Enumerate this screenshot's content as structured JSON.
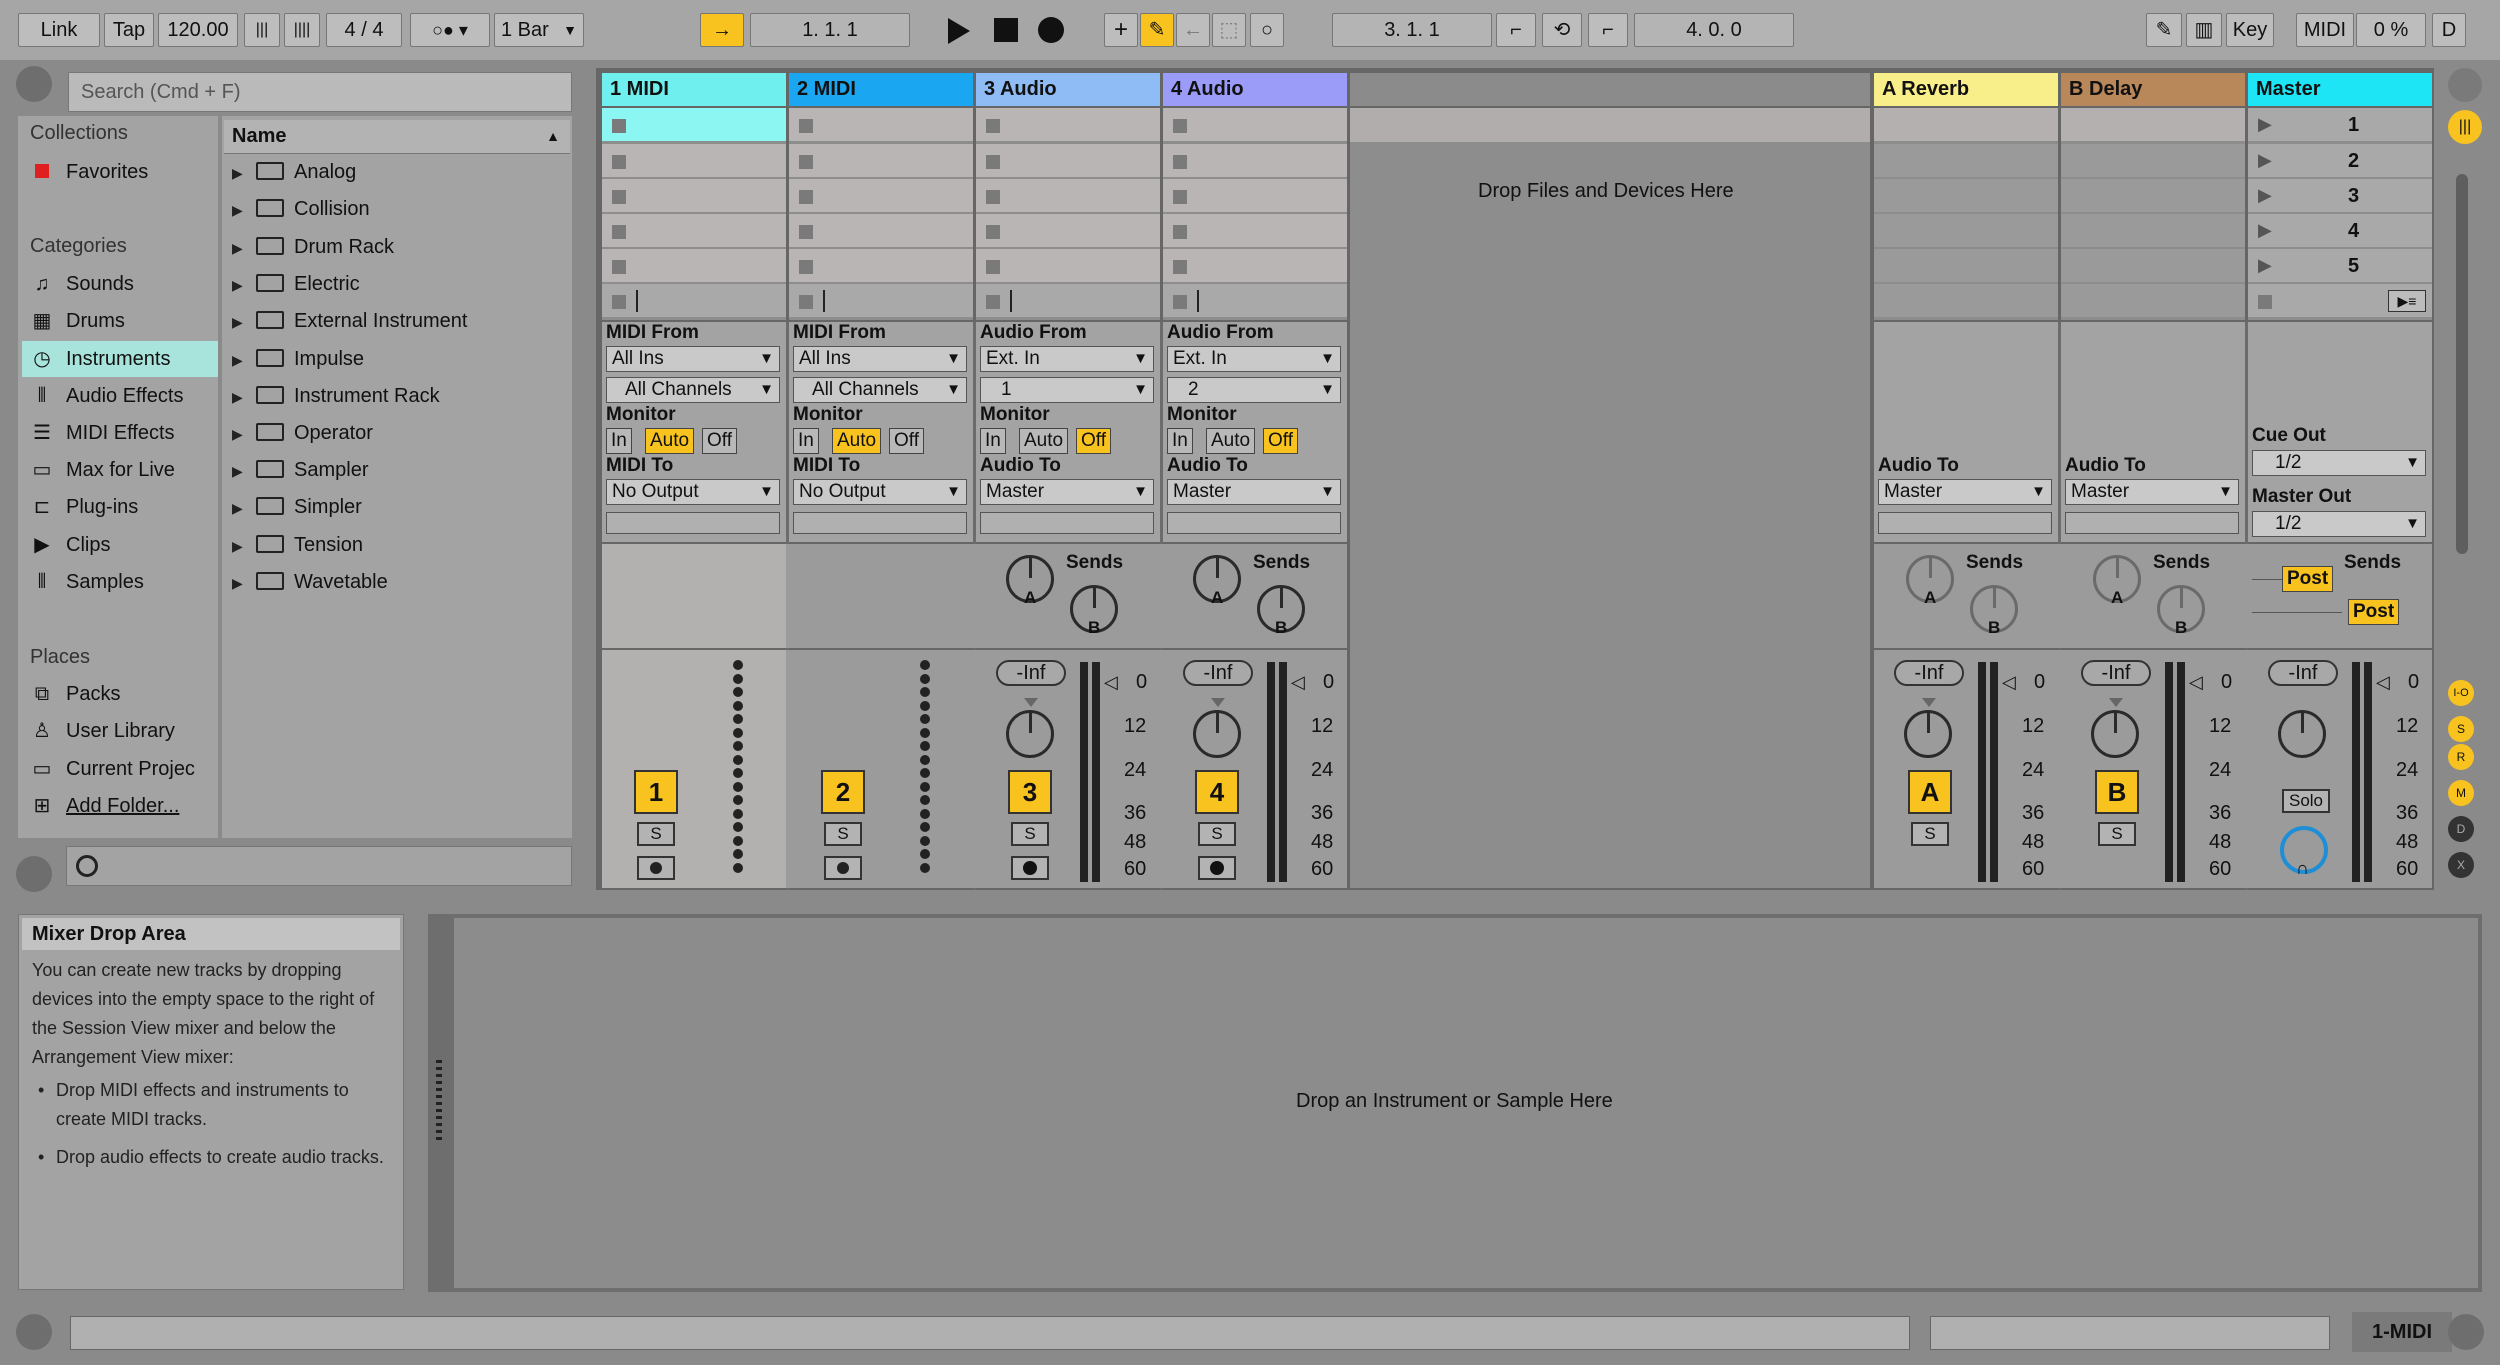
{
  "control_bar": {
    "link": "Link",
    "tap": "Tap",
    "tempo": "120.00",
    "signature": "4 / 4",
    "quantize": "1 Bar",
    "position": "1.   1.   1",
    "loop_start": "3.   1.   1",
    "loop_length": "4.   0.   0",
    "key": "Key",
    "midi": "MIDI",
    "cpu": "0 %",
    "d": "D"
  },
  "browser": {
    "search_placeholder": "Search (Cmd + F)",
    "collections_title": "Collections",
    "favorites": "Favorites",
    "categories_title": "Categories",
    "categories": [
      "Sounds",
      "Drums",
      "Instruments",
      "Audio Effects",
      "MIDI Effects",
      "Max for Live",
      "Plug-ins",
      "Clips",
      "Samples"
    ],
    "places_title": "Places",
    "places": [
      "Packs",
      "User Library",
      "Current Projec",
      "Add Folder..."
    ],
    "name_header": "Name",
    "items": [
      "Analog",
      "Collision",
      "Drum Rack",
      "Electric",
      "External Instrument",
      "Impulse",
      "Instrument Rack",
      "Operator",
      "Sampler",
      "Simpler",
      "Tension",
      "Wavetable"
    ]
  },
  "tracks": [
    {
      "name": "1 MIDI",
      "color": "#6ff0ee",
      "from_label": "MIDI From",
      "from": "All Ins",
      "channel": "All Channels",
      "monitor": "Monitor",
      "in": "In",
      "auto": "Auto",
      "off": "Off",
      "to_label": "MIDI To",
      "to": "No Output",
      "number": "1",
      "solo": "S"
    },
    {
      "name": "2 MIDI",
      "color": "#1ba6f2",
      "from_label": "MIDI From",
      "from": "All Ins",
      "channel": "All Channels",
      "monitor": "Monitor",
      "in": "In",
      "auto": "Auto",
      "off": "Off",
      "to_label": "MIDI To",
      "to": "No Output",
      "number": "2",
      "solo": "S"
    },
    {
      "name": "3 Audio",
      "color": "#8fbcf5",
      "from_label": "Audio From",
      "from": "Ext. In",
      "channel": "1",
      "monitor": "Monitor",
      "in": "In",
      "auto": "Auto",
      "off": "Off",
      "to_label": "Audio To",
      "to": "Master",
      "sends": "Sends",
      "vol": "-Inf",
      "number": "3",
      "solo": "S"
    },
    {
      "name": "4 Audio",
      "color": "#9a9cf7",
      "from_label": "Audio From",
      "from": "Ext. In",
      "channel": "2",
      "monitor": "Monitor",
      "in": "In",
      "auto": "Auto",
      "off": "Off",
      "to_label": "Audio To",
      "to": "Master",
      "sends": "Sends",
      "vol": "-Inf",
      "number": "4",
      "solo": "S"
    }
  ],
  "returns": [
    {
      "name": "A Reverb",
      "color": "#f8ee8a",
      "to_label": "Audio To",
      "to": "Master",
      "sends": "Sends",
      "vol": "-Inf",
      "letter": "A",
      "solo": "S"
    },
    {
      "name": "B Delay",
      "color": "#b8875a",
      "to_label": "Audio To",
      "to": "Master",
      "sends": "Sends",
      "vol": "-Inf",
      "letter": "B",
      "solo": "S"
    }
  ],
  "master": {
    "name": "Master",
    "color": "#1ee5f5",
    "scenes": [
      "1",
      "2",
      "3",
      "4",
      "5"
    ],
    "cue_label": "Cue Out",
    "cue": "1/2",
    "out_label": "Master Out",
    "out": "1/2",
    "sends": "Sends",
    "post": "Post",
    "vol": "-Inf",
    "solo": "Solo"
  },
  "send_labels": {
    "a": "A",
    "b": "B"
  },
  "scale": [
    "0",
    "12",
    "24",
    "36",
    "48",
    "60"
  ],
  "drop_files": "Drop Files and Devices Here",
  "info": {
    "title": "Mixer Drop Area",
    "body": "You can create new tracks by dropping devices into the empty space to the right of the Session View mixer and below the Arrangement View mixer:",
    "bullets": [
      "Drop MIDI effects and instruments to create MIDI tracks.",
      "Drop audio effects to create audio tracks."
    ]
  },
  "device_drop": "Drop an Instrument or Sample Here",
  "status_track": "1-MIDI",
  "side_letters": [
    "I-O",
    "S",
    "R",
    "M",
    "D",
    "X"
  ]
}
